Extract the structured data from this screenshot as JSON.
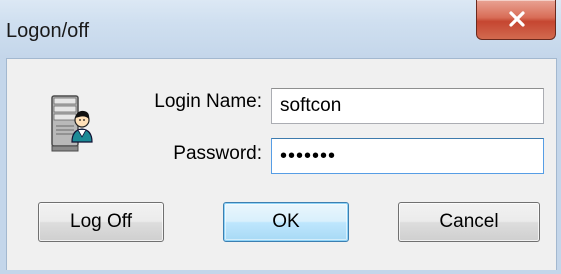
{
  "window": {
    "title": "Logon/off",
    "close_icon": "close-x-icon"
  },
  "form": {
    "user_icon": "server-user-icon",
    "login_label": "Login Name:",
    "login_value": "softcon",
    "password_label": "Password:",
    "password_value": "•••••••"
  },
  "buttons": {
    "logoff_label": "Log Off",
    "ok_label": "OK",
    "cancel_label": "Cancel"
  },
  "colors": {
    "titlebar": "#c4d6ea",
    "close_button": "#c54631",
    "default_button": "#bee6fd",
    "focus_border": "#569de5"
  }
}
